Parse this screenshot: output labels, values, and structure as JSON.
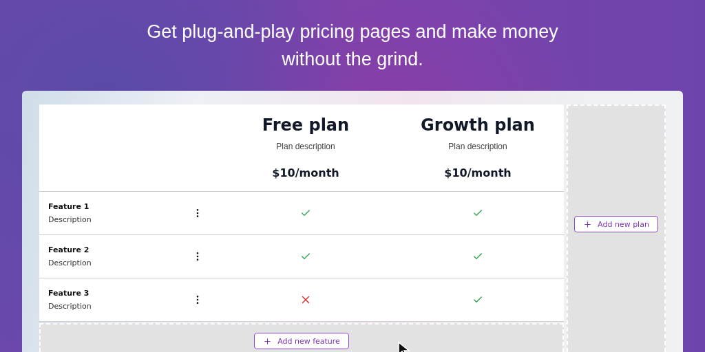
{
  "hero": {
    "subtitle": "Get plug-and-play pricing pages and make money without the grind."
  },
  "plans": [
    {
      "name": "Free plan",
      "description": "Plan description",
      "price": "$10/month"
    },
    {
      "name": "Growth plan",
      "description": "Plan description",
      "price": "$10/month"
    }
  ],
  "features": [
    {
      "name": "Feature 1",
      "description": "Description",
      "included": [
        true,
        true
      ]
    },
    {
      "name": "Feature 2",
      "description": "Description",
      "included": [
        true,
        true
      ]
    },
    {
      "name": "Feature 3",
      "description": "Description",
      "included": [
        false,
        true
      ]
    }
  ],
  "add_plan_button": "Add new plan",
  "add_feature_button": "Add new feature"
}
